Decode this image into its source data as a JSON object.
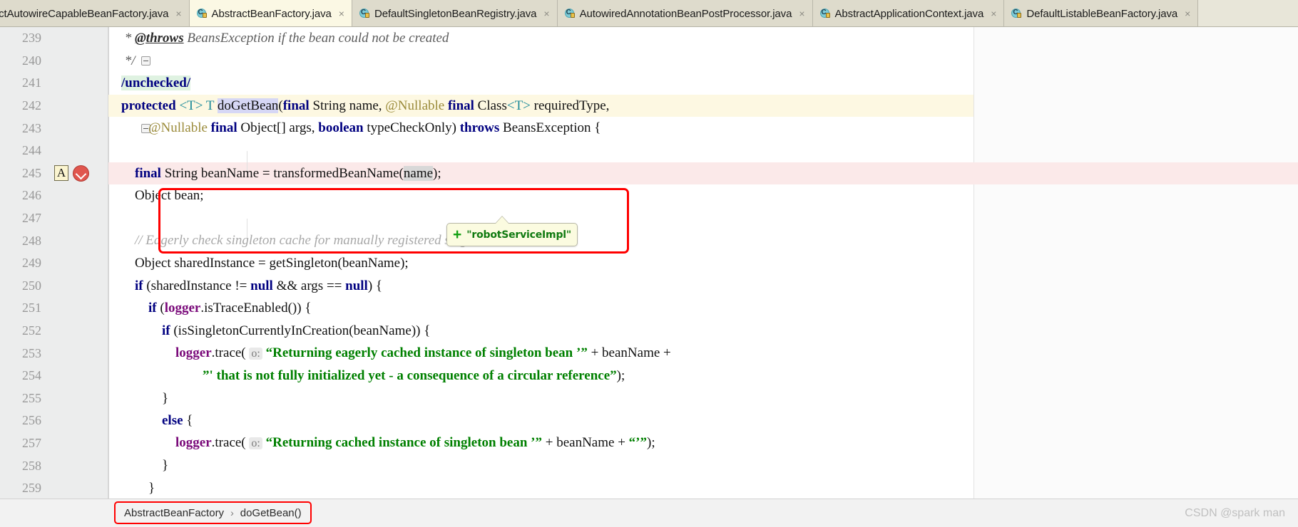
{
  "tabs": [
    {
      "label": "ractAutowireCapableBeanFactory.java",
      "active": false,
      "clipped": true
    },
    {
      "label": "AbstractBeanFactory.java",
      "active": true,
      "clipped": false
    },
    {
      "label": "DefaultSingletonBeanRegistry.java",
      "active": false,
      "clipped": false
    },
    {
      "label": "AutowiredAnnotationBeanPostProcessor.java",
      "active": false,
      "clipped": false
    },
    {
      "label": "AbstractApplicationContext.java",
      "active": false,
      "clipped": false
    },
    {
      "label": "DefaultListableBeanFactory.java",
      "active": false,
      "clipped": false
    }
  ],
  "tab_close_glyph": "×",
  "editor": {
    "lines": [
      {
        "no": "239",
        "code": " * @throws BeansException if the bean could not be created"
      },
      {
        "no": "240",
        "code": " */"
      },
      {
        "no": "241",
        "code": "/unchecked/"
      },
      {
        "no": "242",
        "code": "protected <T> T doGetBean(final String name, @Nullable final Class<T> requiredType,"
      },
      {
        "no": "243",
        "code": "        @Nullable final Object[] args, boolean typeCheckOnly) throws BeansException {"
      },
      {
        "no": "244",
        "code": ""
      },
      {
        "no": "245",
        "code": "    final String beanName = transformedBeanName(name);"
      },
      {
        "no": "246",
        "code": "    Object bean;"
      },
      {
        "no": "247",
        "code": ""
      },
      {
        "no": "248",
        "code": "    // Eagerly check singleton cache for manually registered singletons."
      },
      {
        "no": "249",
        "code": "    Object sharedInstance = getSingleton(beanName);"
      },
      {
        "no": "250",
        "code": "    if (sharedInstance != null && args == null) {"
      },
      {
        "no": "251",
        "code": "        if (logger.isTraceEnabled()) {"
      },
      {
        "no": "252",
        "code": "            if (isSingletonCurrentlyInCreation(beanName)) {"
      },
      {
        "no": "253",
        "code": "                logger.trace( o: “Returning eagerly cached instance of singleton bean ’” + beanName +"
      },
      {
        "no": "254",
        "code": "                        ”' that is not fully initialized yet - a consequence of a circular reference”);"
      },
      {
        "no": "255",
        "code": "            }"
      },
      {
        "no": "256",
        "code": "            else {"
      },
      {
        "no": "257",
        "code": "                logger.trace( o: “Returning cached instance of singleton bean ’” + beanName + “’”);"
      },
      {
        "no": "258",
        "code": "            }"
      },
      {
        "no": "259",
        "code": "        }"
      }
    ],
    "param_hint": "o:",
    "gutter": {
      "inspection_letter": "A",
      "breakpoint_name": "red-chevron-icon"
    }
  },
  "tooltip": {
    "plus": "+",
    "text": "\"robotServiceImpl\""
  },
  "breadcrumb": {
    "class": "AbstractBeanFactory",
    "separator": "›",
    "method": "doGetBean()"
  },
  "watermark": "CSDN @spark man",
  "colors": {
    "keyword": "#000080",
    "string": "#008000",
    "comment": "#a8a8a8",
    "annotation": "#9b8b3a",
    "field": "#7a0a7a",
    "generic": "#1d8a9a",
    "highlight_border": "#ff0000",
    "tooltip_bg": "#fbfbe0",
    "tooltip_text": "#107a10",
    "error_line_bg": "#fbe9e9",
    "caret_line_bg": "#fdf8e2"
  }
}
